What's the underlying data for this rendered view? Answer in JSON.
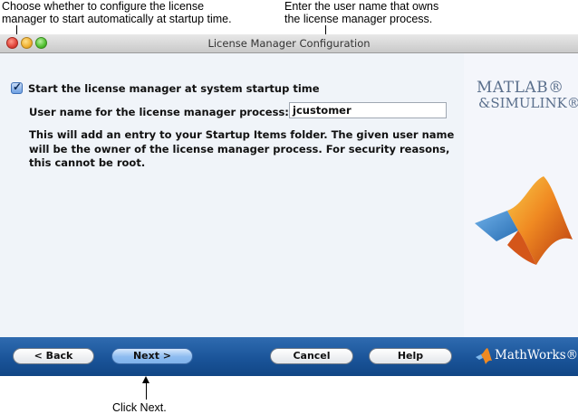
{
  "callouts": {
    "start_checkbox": "Choose whether to configure the license\nmanager to start automatically at startup time.",
    "username": "Enter the user name that owns\nthe license manager process.",
    "next": "Click Next."
  },
  "window": {
    "title": "License Manager Configuration"
  },
  "form": {
    "startup_checkbox": {
      "label": "Start the license manager at system startup time",
      "checked": true
    },
    "username": {
      "label": "User name for the license manager process:",
      "value": "jcustomer"
    },
    "description": "This will add an entry to your Startup Items folder. The given user name will be the owner of the license manager process. For security reasons, this cannot be root."
  },
  "branding": {
    "matlab": "MATLAB®",
    "simulink": "&SIMULINK®",
    "mathworks": "MathWorks®"
  },
  "buttons": {
    "back": "< Back",
    "next": "Next >",
    "cancel": "Cancel",
    "help": "Help"
  },
  "colors": {
    "button_bar": "#1a5499",
    "default_button": "#8dbcf0",
    "logo_text": "#5a6f8c"
  }
}
